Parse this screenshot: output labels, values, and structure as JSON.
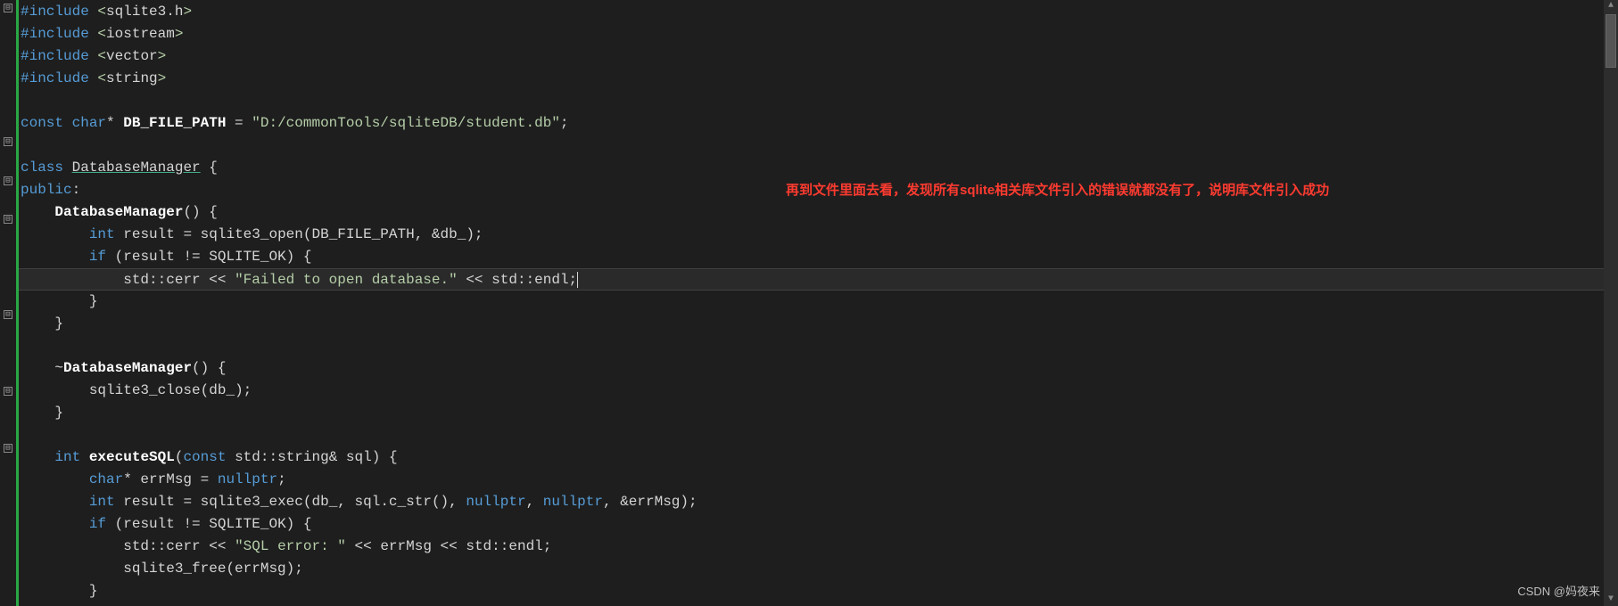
{
  "annotation_text": "再到文件里面去看，发现所有sqlite相关库文件引入的错误就都没有了，说明库文件引入成功",
  "watermark_text": "CSDN @妈夜来",
  "fold_glyph": "⊟",
  "scroll_up_glyph": "▲",
  "scroll_down_glyph": "▼",
  "code": {
    "l1": {
      "pre": "",
      "kw": "#include",
      "sp": " ",
      "ang1": "<",
      "hdr": "sqlite3.h",
      "ang2": ">"
    },
    "l2": {
      "pre": "",
      "kw": "#include",
      "sp": " ",
      "ang1": "<",
      "hdr": "iostream",
      "ang2": ">"
    },
    "l3": {
      "pre": "",
      "kw": "#include",
      "sp": " ",
      "ang1": "<",
      "hdr": "vector",
      "ang2": ">"
    },
    "l4": {
      "pre": "",
      "kw": "#include",
      "sp": " ",
      "ang1": "<",
      "hdr": "string",
      "ang2": ">"
    },
    "l6": {
      "kw1": "const",
      "sp1": " ",
      "kw2": "char",
      "op": "* ",
      "name": "DB_FILE_PATH",
      "eq": " = ",
      "str": "\"D:/commonTools/sqliteDB/student.db\"",
      "semi": ";"
    },
    "l8": {
      "kw": "class",
      "sp": " ",
      "name": "DatabaseManager",
      "brace": " {"
    },
    "l9": {
      "kw": "public",
      "colon": ":"
    },
    "l10": {
      "indent": "    ",
      "name": "DatabaseManager",
      "paren": "()",
      "brace": " {"
    },
    "l11": {
      "indent": "        ",
      "type": "int",
      "sp": " ",
      "var": "result",
      "eq": " = ",
      "fn": "sqlite3_open",
      "open": "(",
      "arg1": "DB_FILE_PATH",
      "c": ", ",
      "amp": "&",
      "arg2": "db_",
      "close": ");"
    },
    "l12": {
      "indent": "        ",
      "kw": "if",
      "sp": " ",
      "open": "(",
      "var": "result",
      "neq": " != ",
      "cst": "SQLITE_OK",
      "close": ")",
      "brace": " {"
    },
    "l13": {
      "indent": "            ",
      "ns": "std",
      "cc1": "::",
      "cerr": "cerr",
      "sp1": " ",
      "op1": "<<",
      "sp2": " ",
      "str": "\"Failed to open database.\"",
      "sp3": " ",
      "op2": "<<",
      "sp4": " ",
      "ns2": "std",
      "cc2": "::",
      "endl": "endl",
      "semi": ";"
    },
    "l14": {
      "indent": "        ",
      "brace": "}"
    },
    "l15": {
      "indent": "    ",
      "brace": "}"
    },
    "l17": {
      "indent": "    ",
      "tilde": "~",
      "name": "DatabaseManager",
      "paren": "()",
      "brace": " {"
    },
    "l18": {
      "indent": "        ",
      "fn": "sqlite3_close",
      "open": "(",
      "arg": "db_",
      "close": ");"
    },
    "l19": {
      "indent": "    ",
      "brace": "}"
    },
    "l21": {
      "indent": "    ",
      "ret": "int",
      "sp1": " ",
      "name": "executeSQL",
      "open": "(",
      "kw": "const",
      "sp2": " ",
      "ty": "std::string",
      "amp": "&",
      "sp3": " ",
      "arg": "sql",
      "close": ")",
      "brace": " {"
    },
    "l22": {
      "indent": "        ",
      "type": "char",
      "star": "* ",
      "var": "errMsg",
      "eq": " = ",
      "kw": "nullptr",
      "semi": ";"
    },
    "l23": {
      "indent": "        ",
      "type": "int",
      "sp": " ",
      "var": "result",
      "eq": " = ",
      "fn": "sqlite3_exec",
      "open": "(",
      "a1": "db_",
      "c1": ", ",
      "a2": "sql",
      "dot": ".",
      "m": "c_str",
      "p": "()",
      "c2": ", ",
      "n1": "nullptr",
      "c3": ", ",
      "n2": "nullptr",
      "c4": ", ",
      "amp": "&",
      "a3": "errMsg",
      "close": ");"
    },
    "l24": {
      "indent": "        ",
      "kw": "if",
      "sp": " ",
      "open": "(",
      "var": "result",
      "neq": " != ",
      "cst": "SQLITE_OK",
      "close": ")",
      "brace": " {"
    },
    "l25": {
      "indent": "            ",
      "ns": "std",
      "cc1": "::",
      "cerr": "cerr",
      "sp1": " ",
      "op1": "<<",
      "sp2": " ",
      "str": "\"SQL error: \"",
      "sp3": " ",
      "op2": "<<",
      "sp4": " ",
      "var": "errMsg",
      "sp5": " ",
      "op3": "<<",
      "sp6": " ",
      "ns2": "std",
      "cc2": "::",
      "endl": "endl",
      "semi": ";"
    },
    "l26": {
      "indent": "            ",
      "fn": "sqlite3_free",
      "open": "(",
      "arg": "errMsg",
      "close": ");"
    },
    "l27": {
      "indent": "        ",
      "brace": "}"
    }
  }
}
